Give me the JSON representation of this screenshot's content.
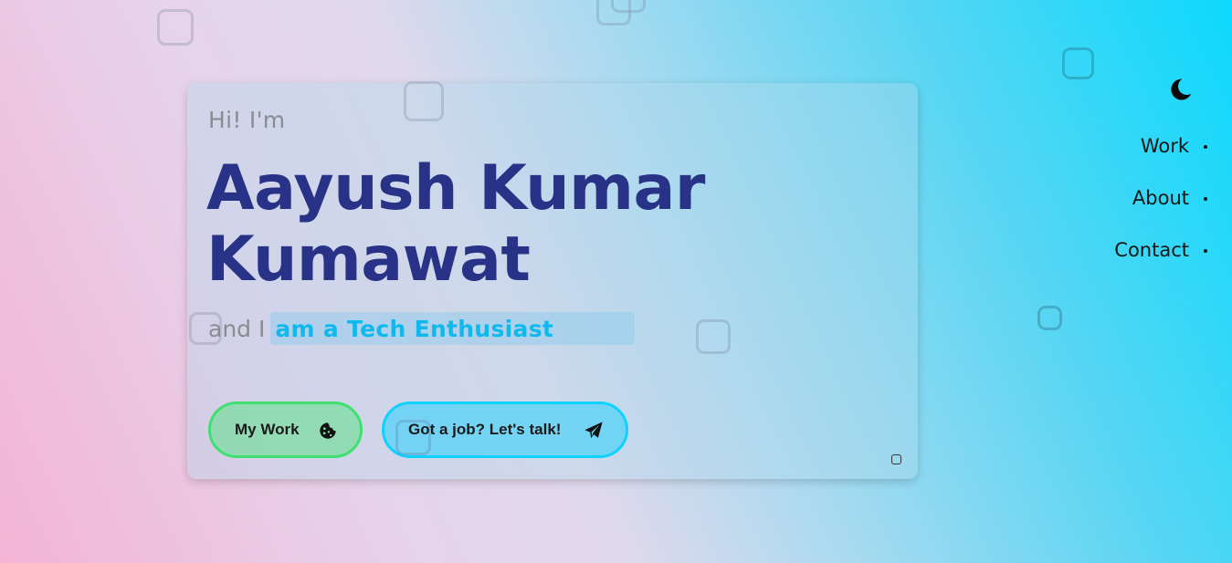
{
  "hero": {
    "greeting": "Hi! I'm",
    "name_line_1": "Aayush Kumar",
    "name_line_2": "Kumawat",
    "tagline_prefix": "and I",
    "tagline_typed": "am a Tech Enthusiast",
    "buttons": {
      "work_label": "My Work",
      "work_icon": "cookie-icon",
      "talk_label": "Got a job? Let's talk!",
      "talk_icon": "paper-plane-icon"
    }
  },
  "header": {
    "theme_toggle_icon": "moon-icon"
  },
  "nav": {
    "items": [
      {
        "label": "Work"
      },
      {
        "label": "About"
      },
      {
        "label": "Contact"
      }
    ]
  },
  "colors": {
    "name": "#283286",
    "typed_text": "#10b9ed",
    "work_button_border": "#3fe06f",
    "talk_button_border": "#0fd2ff",
    "muted_text": "#8a8c92"
  }
}
